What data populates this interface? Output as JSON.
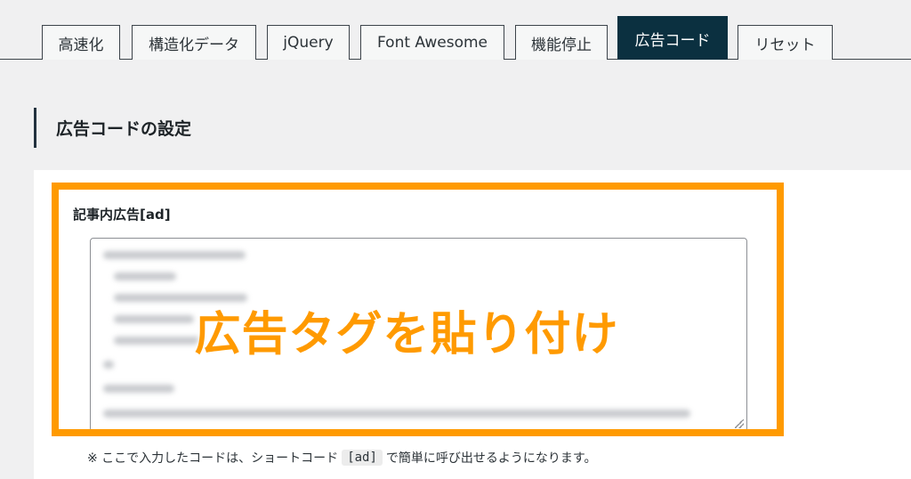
{
  "tabs": [
    {
      "label": "高速化",
      "active": false
    },
    {
      "label": "構造化データ",
      "active": false
    },
    {
      "label": "jQuery",
      "active": false
    },
    {
      "label": "Font Awesome",
      "active": false
    },
    {
      "label": "機能停止",
      "active": false
    },
    {
      "label": "広告コード",
      "active": true
    },
    {
      "label": "リセット",
      "active": false
    }
  ],
  "section": {
    "title": "広告コードの設定"
  },
  "ad_field": {
    "label": "記事内広告[ad]",
    "value": ""
  },
  "overlay": {
    "caption": "広告タグを貼り付け",
    "color": "#ff9a00"
  },
  "note": {
    "prefix": "※ ここで入力したコードは、ショートコード",
    "code": "[ad]",
    "suffix": "で簡単に呼び出せるようになります。"
  },
  "colors": {
    "active_tab": "#0b3040",
    "highlight": "#ff9a00"
  }
}
